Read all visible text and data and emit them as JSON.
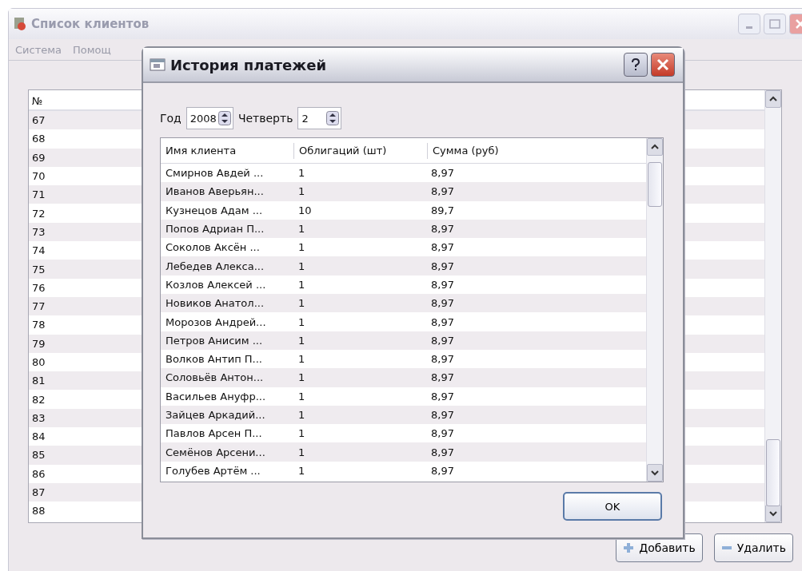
{
  "main_window": {
    "title": "Список клиентов",
    "menu": [
      "Система",
      "Помощ"
    ],
    "table": {
      "columns": [
        "№"
      ],
      "rows": [
        "67",
        "68",
        "69",
        "70",
        "71",
        "72",
        "73",
        "74",
        "75",
        "76",
        "77",
        "78",
        "79",
        "80",
        "81",
        "82",
        "83",
        "84",
        "85",
        "86",
        "87",
        "88"
      ]
    },
    "buttons": [
      {
        "label": "Добавить",
        "kind": "add"
      },
      {
        "label": "Удалить",
        "kind": "remove"
      }
    ]
  },
  "dialog": {
    "title": "История платежей",
    "year_label": "Год",
    "year": "2008",
    "quarter_label": "Четверть",
    "quarter": "2",
    "table": {
      "columns": [
        "Имя клиента",
        "Облигаций (шт)",
        "Сумма (руб)"
      ],
      "rows": [
        [
          "Смирнов Авдей ...",
          "1",
          "8,97"
        ],
        [
          "Иванов Аверьян...",
          "1",
          "8,97"
        ],
        [
          "Кузнецов Адам ...",
          "10",
          "89,7"
        ],
        [
          "Попов Адриан П...",
          "1",
          "8,97"
        ],
        [
          "Соколов Аксён ...",
          "1",
          "8,97"
        ],
        [
          "Лебедев Алекса...",
          "1",
          "8,97"
        ],
        [
          "Козлов Алексей ...",
          "1",
          "8,97"
        ],
        [
          "Новиков Анатол...",
          "1",
          "8,97"
        ],
        [
          "Морозов Андрей...",
          "1",
          "8,97"
        ],
        [
          "Петров Анисим ...",
          "1",
          "8,97"
        ],
        [
          "Волков Антип П...",
          "1",
          "8,97"
        ],
        [
          "Соловьёв Антон...",
          "1",
          "8,97"
        ],
        [
          "Васильев Ануфр...",
          "1",
          "8,97"
        ],
        [
          "Зайцев Аркадий...",
          "1",
          "8,97"
        ],
        [
          "Павлов Арсен П...",
          "1",
          "8,97"
        ],
        [
          "Семёнов Арсени...",
          "1",
          "8,97"
        ],
        [
          "Голубев Артём ...",
          "1",
          "8,97"
        ]
      ]
    },
    "ok_button": "OK"
  }
}
